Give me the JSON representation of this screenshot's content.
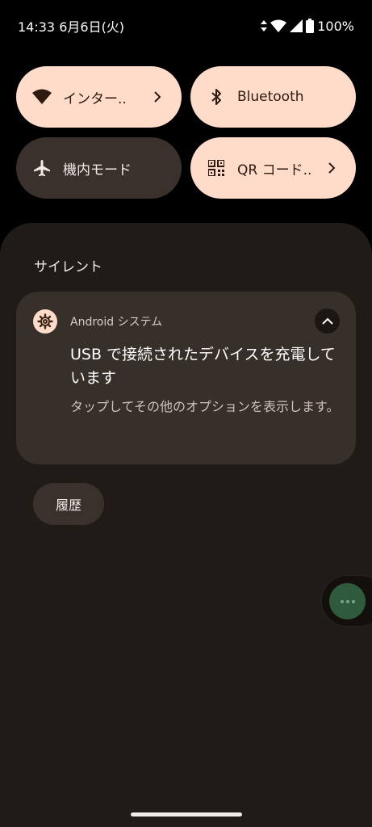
{
  "status_bar": {
    "time": "14:33",
    "date": "6月6日(火)",
    "battery": "100%"
  },
  "quick_tiles": [
    {
      "label": "インター..",
      "icon": "wifi-icon",
      "state": "on",
      "has_chevron": true
    },
    {
      "label": "Bluetooth",
      "icon": "bluetooth-icon",
      "state": "on",
      "has_chevron": false
    },
    {
      "label": "機内モード",
      "icon": "airplane-icon",
      "state": "off",
      "has_chevron": false
    },
    {
      "label": "QR コード..",
      "icon": "qr-code-icon",
      "state": "on",
      "has_chevron": true
    }
  ],
  "shade": {
    "section_title": "サイレント",
    "notification": {
      "app_name": "Android システム",
      "app_icon": "gear-icon",
      "title": "USB で接続されたデバイスを充電しています",
      "body": "タップしてその他のオプションを表示します。"
    },
    "history_label": "履歴"
  },
  "colors": {
    "tile_on": "#ffdbc9",
    "tile_off": "#3a312c",
    "panel": "#211b18",
    "card": "#372f2a",
    "bubble": "#2f5b3c"
  }
}
